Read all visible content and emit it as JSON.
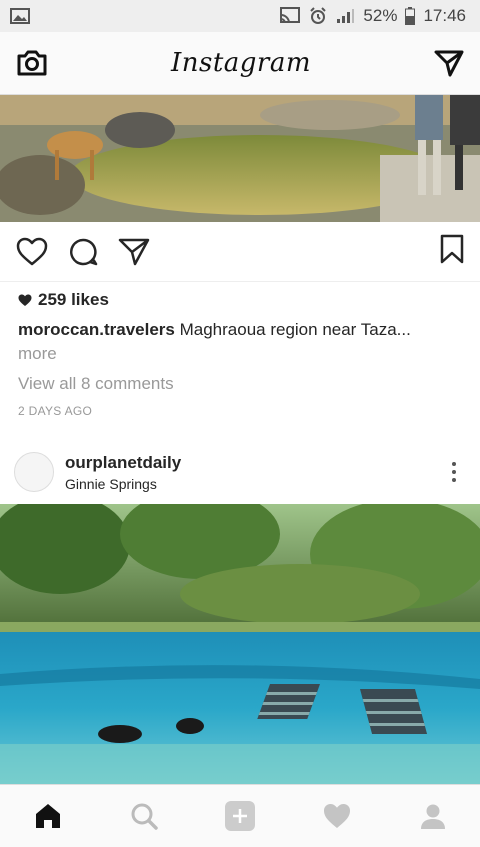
{
  "status_bar": {
    "battery": "52%",
    "time": "17:46"
  },
  "header": {
    "title": "Instagram"
  },
  "post1": {
    "likes": "259 likes",
    "username": "moroccan.travelers",
    "caption": "Maghraoua region near Taza...",
    "more": "more",
    "view_comments": "View all 8 comments",
    "time_ago": "2 DAYS AGO"
  },
  "post2": {
    "username": "ourplanetdaily",
    "location": "Ginnie Springs"
  },
  "colors": {
    "text": "#262626",
    "muted": "#999999",
    "bar": "#fafafa"
  }
}
